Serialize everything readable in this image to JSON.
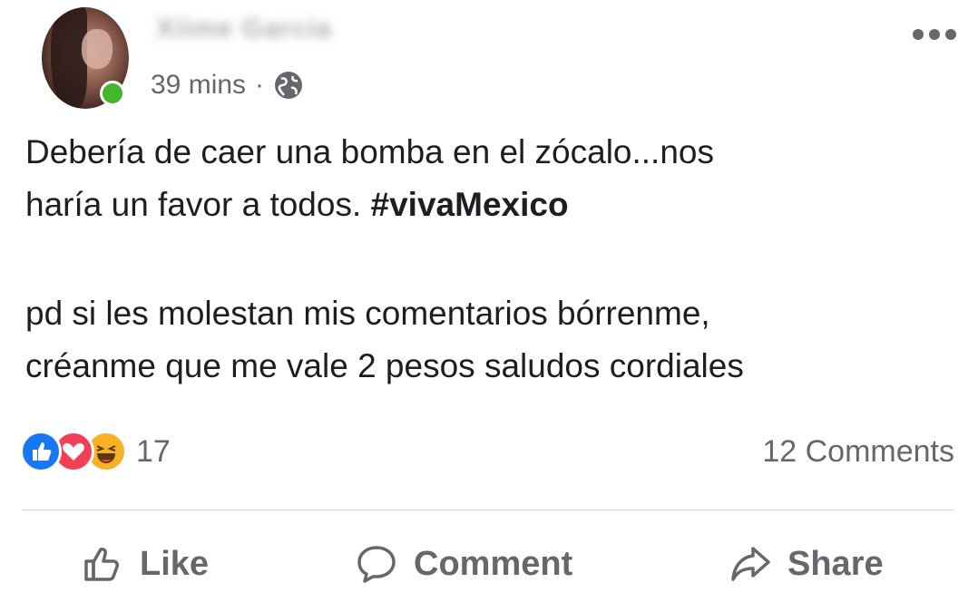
{
  "post": {
    "author_name": "Xiime Garcia",
    "time": "39 mins",
    "separator": "·",
    "privacy_icon": "globe-icon",
    "more_icon": "more-icon",
    "lines": [
      "Debería de caer una bomba en el zócalo...nos",
      "haría un favor a todos.",
      "pd si les molestan mis comentarios bórrenme,",
      "créanme que me vale 2 pesos  saludos cordiales"
    ],
    "hashtag": "#vivaMexico"
  },
  "stats": {
    "reaction_icons": [
      "like-reaction-icon",
      "love-reaction-icon",
      "haha-reaction-icon"
    ],
    "reaction_count": "17",
    "comments": "12 Comments"
  },
  "actions": {
    "like": "Like",
    "comment": "Comment",
    "share": "Share"
  },
  "colors": {
    "like_blue": "#1877f2",
    "love_red": "#f33e58",
    "haha_yellow": "#f7b125",
    "online_green": "#42b72a",
    "secondary_text": "#65676b"
  }
}
